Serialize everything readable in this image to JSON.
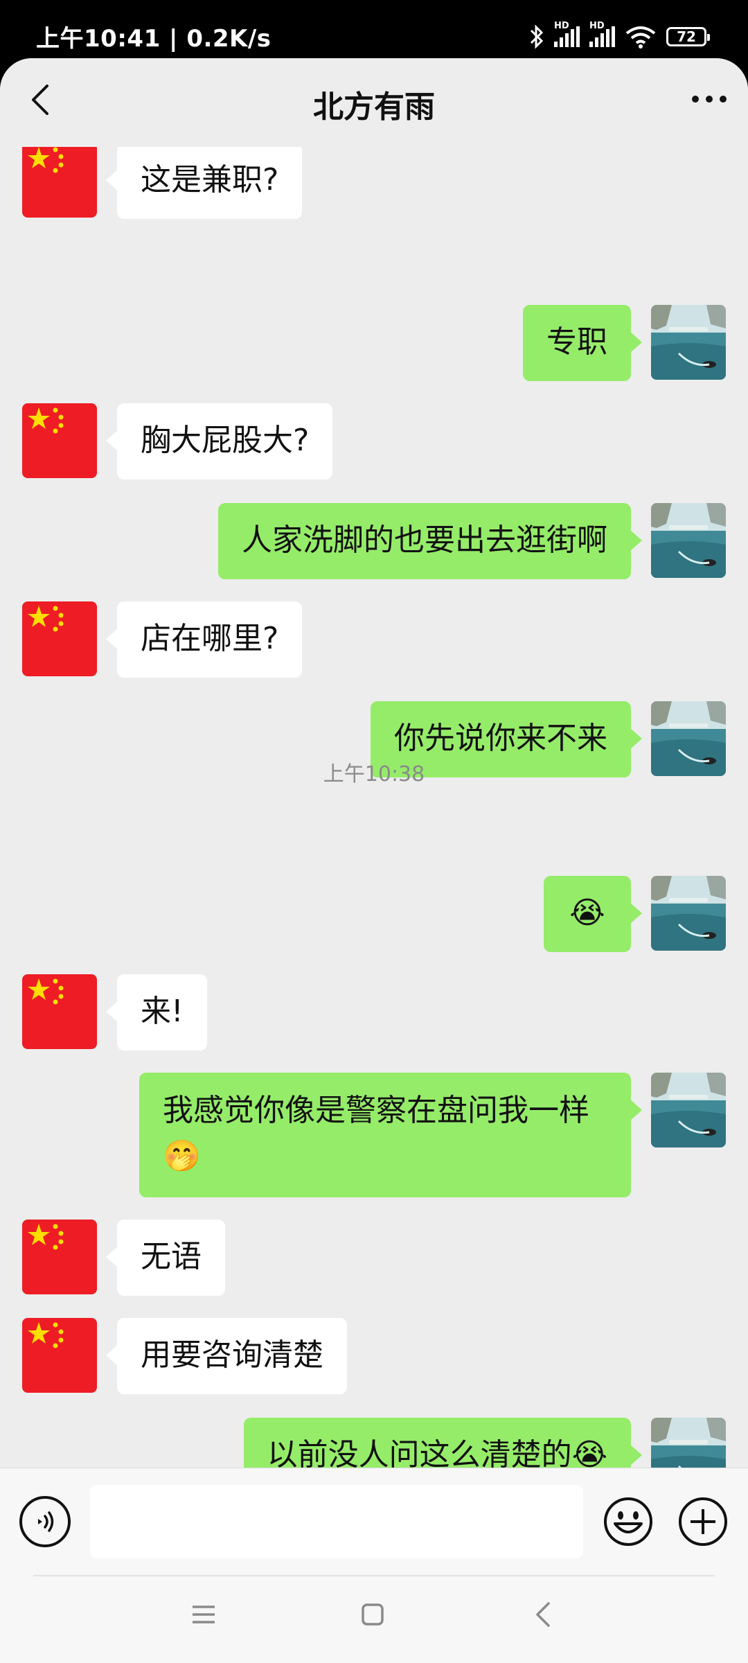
{
  "status_bar": {
    "time_speed": "上午10:41 | 0.2K/s",
    "signal1_label": "HD",
    "signal2_label": "HD",
    "battery": "72"
  },
  "header": {
    "title": "北方有雨"
  },
  "messages": [
    {
      "side": "left",
      "text": "这是兼职?"
    },
    {
      "side": "right",
      "text": "专职"
    },
    {
      "side": "left",
      "text": "胸大屁股大?"
    },
    {
      "side": "right",
      "text": "人家洗脚的也要出去逛街啊"
    },
    {
      "side": "left",
      "text": "店在哪里?"
    },
    {
      "side": "right",
      "text": "你先说你来不来"
    },
    {
      "type": "timestamp",
      "text": "上午10:38"
    },
    {
      "side": "right",
      "text": "😭",
      "emoji_name": "laughing-crying-emoji"
    },
    {
      "side": "left",
      "text": "来!"
    },
    {
      "side": "right",
      "text": "我感觉你像是警察在盘问我一样🤭"
    },
    {
      "side": "left",
      "text": "无语"
    },
    {
      "side": "left",
      "text": "用要咨询清楚"
    },
    {
      "side": "right",
      "text": "以前没人问这么清楚的😭"
    }
  ],
  "input": {
    "value": "",
    "placeholder": ""
  },
  "icons": {
    "back": "back-arrow-icon",
    "more": "more-dots-icon",
    "voice": "voice-icon",
    "emoji": "emoji-icon",
    "plus": "plus-icon",
    "nav_menu": "menu-icon",
    "nav_home": "home-square-icon",
    "nav_back": "back-triangle-icon"
  },
  "colors": {
    "sent_bubble": "#95ec69",
    "received_bubble": "#ffffff",
    "chat_background": "#ededed"
  }
}
